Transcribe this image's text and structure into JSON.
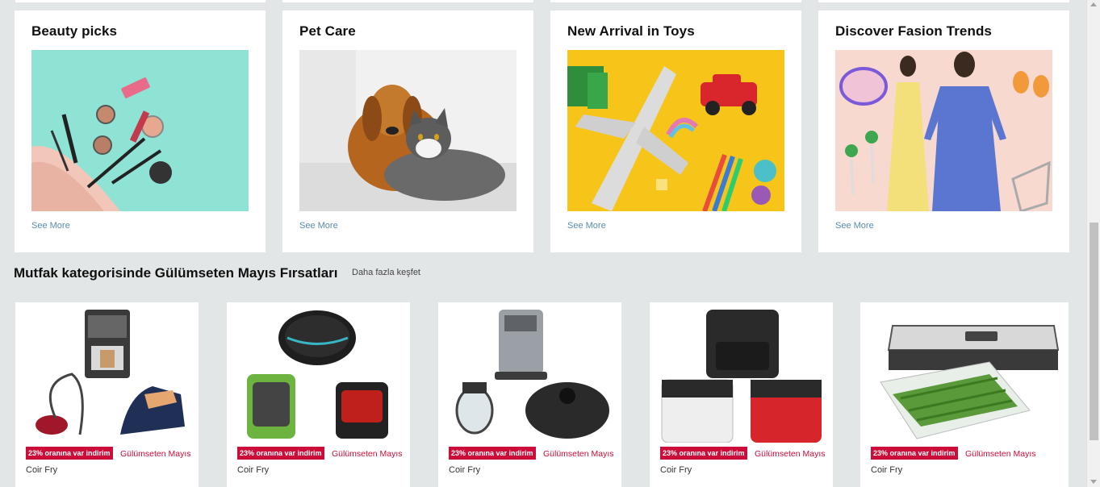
{
  "categories": [
    {
      "title": "Beauty picks",
      "link": "See More",
      "image": "makeup-products-image"
    },
    {
      "title": "Pet Care",
      "link": "See More",
      "image": "dog-and-cat-image"
    },
    {
      "title": "New Arrival in Toys",
      "link": "See More",
      "image": "toys-image"
    },
    {
      "title": "Discover Fasion Trends",
      "link": "See More",
      "image": "fashion-models-image"
    }
  ],
  "section": {
    "title": "Mutfak kategorisinde Gülümseten Mayıs Fırsatları",
    "link": "Daha fazla keşfet"
  },
  "deals": [
    {
      "badge": "23% oranına var indirim",
      "label": "Gülümseten Mayıs",
      "name": "Coir Fry",
      "image": "coffee-machine-vacuum-iron-image"
    },
    {
      "badge": "23% oranına var indirim",
      "label": "Gülümseten Mayıs",
      "name": "Coir Fry",
      "image": "robot-vacuum-carpet-cleaner-image"
    },
    {
      "badge": "23% oranına var indirim",
      "label": "Gülümseten Mayıs",
      "name": "Coir Fry",
      "image": "espresso-kettle-robot-image"
    },
    {
      "badge": "23% oranına var indirim",
      "label": "Gülümseten Mayıs",
      "name": "Coir Fry",
      "image": "air-fryers-image"
    },
    {
      "badge": "23% oranına var indirim",
      "label": "Gülümseten Mayıs",
      "name": "Coir Fry",
      "image": "vacuum-sealer-image"
    }
  ],
  "colors": {
    "badge": "#cc0c39",
    "link": "#5a8bb0",
    "background": "#e3e6e6"
  }
}
